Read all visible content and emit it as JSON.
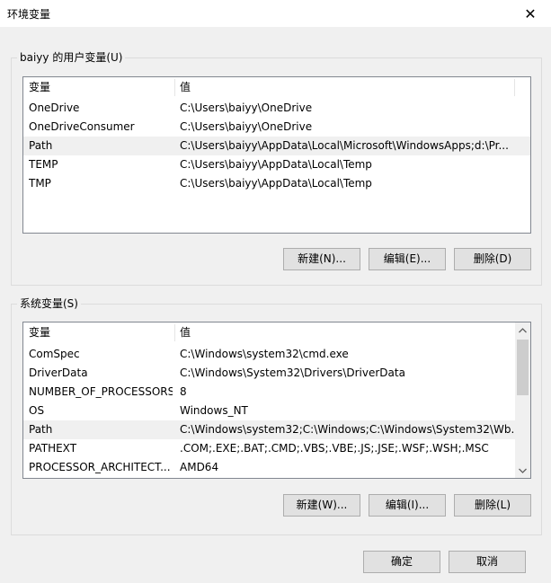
{
  "window": {
    "title": "环境变量",
    "close_glyph": "✕"
  },
  "user_vars": {
    "legend": "baiyy 的用户变量(U)",
    "col_name": "变量",
    "col_value": "值",
    "rows": [
      {
        "name": "OneDrive",
        "value": "C:\\Users\\baiyy\\OneDrive"
      },
      {
        "name": "OneDriveConsumer",
        "value": "C:\\Users\\baiyy\\OneDrive"
      },
      {
        "name": "Path",
        "value": "C:\\Users\\baiyy\\AppData\\Local\\Microsoft\\WindowsApps;d:\\Pr..."
      },
      {
        "name": "TEMP",
        "value": "C:\\Users\\baiyy\\AppData\\Local\\Temp"
      },
      {
        "name": "TMP",
        "value": "C:\\Users\\baiyy\\AppData\\Local\\Temp"
      }
    ],
    "selected_index": 2,
    "buttons": {
      "new": "新建(N)...",
      "edit": "编辑(E)...",
      "delete": "删除(D)"
    }
  },
  "system_vars": {
    "legend": "系统变量(S)",
    "col_name": "变量",
    "col_value": "值",
    "rows": [
      {
        "name": "ComSpec",
        "value": "C:\\Windows\\system32\\cmd.exe"
      },
      {
        "name": "DriverData",
        "value": "C:\\Windows\\System32\\Drivers\\DriverData"
      },
      {
        "name": "NUMBER_OF_PROCESSORS",
        "value": "8"
      },
      {
        "name": "OS",
        "value": "Windows_NT"
      },
      {
        "name": "Path",
        "value": "C:\\Windows\\system32;C:\\Windows;C:\\Windows\\System32\\Wb..."
      },
      {
        "name": "PATHEXT",
        "value": ".COM;.EXE;.BAT;.CMD;.VBS;.VBE;.JS;.JSE;.WSF;.WSH;.MSC"
      },
      {
        "name": "PROCESSOR_ARCHITECT...",
        "value": "AMD64"
      }
    ],
    "selected_index": 4,
    "buttons": {
      "new": "新建(W)...",
      "edit": "编辑(I)...",
      "delete": "删除(L)"
    }
  },
  "footer": {
    "ok": "确定",
    "cancel": "取消"
  }
}
